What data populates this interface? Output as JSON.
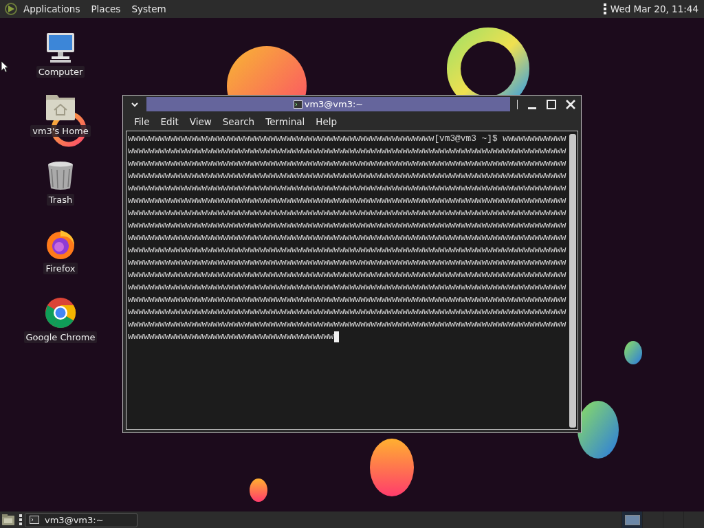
{
  "top_panel": {
    "menus": [
      "Applications",
      "Places",
      "System"
    ],
    "clock": "Wed Mar 20, 11:44"
  },
  "desktop_icons": [
    {
      "kind": "computer",
      "label": "Computer"
    },
    {
      "kind": "home",
      "label": "vm3's Home"
    },
    {
      "kind": "trash",
      "label": "Trash"
    },
    {
      "kind": "firefox",
      "label": "Firefox"
    },
    {
      "kind": "chrome",
      "label": "Google Chrome"
    }
  ],
  "terminal": {
    "title": "vm3@vm3:~",
    "menu": [
      "File",
      "Edit",
      "View",
      "Search",
      "Terminal",
      "Help"
    ],
    "lines": [
      "wwwwwwwwwwwwwwwwwwwwwwwwwwwwwwwwwwwwwwwwwwwwwwwwwwwwwwwwww[vm3@vm3 ~]$ wwwwwwwwwwww",
      "wwwwwwwwwwwwwwwwwwwwwwwwwwwwwwwwwwwwwwwwwwwwwwwwwwwwwwwwwwwwwwwwwwwwwwwwwwwwwwwwwww",
      "wwwwwwwwwwwwwwwwwwwwwwwwwwwwwwwwwwwwwwwwwwwwwwwwwwwwwwwwwwwwwwwwwwwwwwwwwwwwwwwwwww",
      "wwwwwwwwwwwwwwwwwwwwwwwwwwwwwwwwwwwwwwwwwwwwwwwwwwwwwwwwwwwwwwwwwwwwwwwwwwwwwwwwwww",
      "wwwwwwwwwwwwwwwwwwwwwwwwwwwwwwwwwwwwwwwwwwwwwwwwwwwwwwwwwwwwwwwwwwwwwwwwwwwwwwwwwww",
      "wwwwwwwwwwwwwwwwwwwwwwwwwwwwwwwwwwwwwwwwwwwwwwwwwwwwwwwwwwwwwwwwwwwwwwwwwwwwwwwwwww",
      "wwwwwwwwwwwwwwwwwwwwwwwwwwwwwwwwwwwwwwwwwwwwwwwwwwwwwwwwwwwwwwwwwwwwwwwwwwwwwwwwwww",
      "wwwwwwwwwwwwwwwwwwwwwwwwwwwwwwwwwwwwwwwwwwwwwwwwwwwwwwwwwwwwwwwwwwwwwwwwwwwwwwwwwww",
      "wwwwwwwwwwwwwwwwwwwwwwwwwwwwwwwwwwwwwwwwwwwwwwwwwwwwwwwwwwwwwwwwwwwwwwwwwwwwwwwwwww",
      "wwwwwwwwwwwwwwwwwwwwwwwwwwwwwwwwwwwwwwwwwwwwwwwwwwwwwwwwwwwwwwwwwwwwwwwwwwwwwwwwwww",
      "wwwwwwwwwwwwwwwwwwwwwwwwwwwwwwwwwwwwwwwwwwwwwwwwwwwwwwwwwwwwwwwwwwwwwwwwwwwwwwwwwww",
      "wwwwwwwwwwwwwwwwwwwwwwwwwwwwwwwwwwwwwwwwwwwwwwwwwwwwwwwwwwwwwwwwwwwwwwwwwwwwwwwwwww",
      "wwwwwwwwwwwwwwwwwwwwwwwwwwwwwwwwwwwwwwwwwwwwwwwwwwwwwwwwwwwwwwwwwwwwwwwwwwwwwwwwwww",
      "wwwwwwwwwwwwwwwwwwwwwwwwwwwwwwwwwwwwwwwwwwwwwwwwwwwwwwwwwwwwwwwwwwwwwwwwwwwwwwwwwww",
      "wwwwwwwwwwwwwwwwwwwwwwwwwwwwwwwwwwwwwwwwwwwwwwwwwwwwwwwwwwwwwwwwwwwwwwwwwwwwwwwwwww",
      "wwwwwwwwwwwwwwwwwwwwwwwwwwwwwwwwwwwwwwwwwwwwwwwwwwwwwwwwwwwwwwwwwwwwwwwwwwwwwwwwwww",
      "wwwwwwwwwwwwwwwwwwwwwwwwwwwwwwwwwwwwwww"
    ]
  },
  "taskbar": {
    "tasks": [
      {
        "title": "vm3@vm3:~"
      }
    ],
    "workspaces": [
      {
        "selected": true
      },
      {
        "selected": false
      },
      {
        "selected": false
      },
      {
        "selected": false
      }
    ]
  }
}
